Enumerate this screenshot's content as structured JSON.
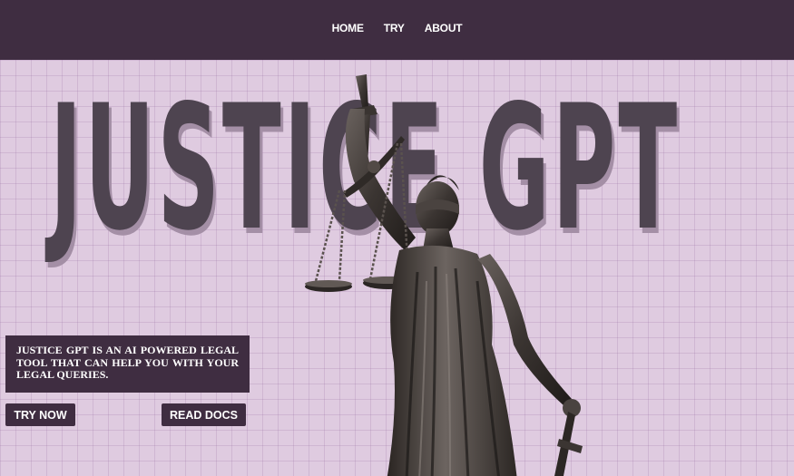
{
  "nav": {
    "items": [
      {
        "label": "HOME"
      },
      {
        "label": "TRY"
      },
      {
        "label": "ABOUT"
      }
    ]
  },
  "hero": {
    "title": "JUSTICE GPT",
    "description": "JUSTICE GPT IS AN AI POWERED LEGAL TOOL THAT CAN HELP YOU WITH YOUR LEGAL QUERIES.",
    "try_label": "TRY NOW",
    "docs_label": "READ DOCS"
  },
  "colors": {
    "nav_bg": "#3f2d41",
    "hero_bg": "#dfcbe0",
    "title": "#4e4450",
    "button_bg": "#3f2d41",
    "text_light": "#ffffff"
  },
  "images": {
    "statue": "lady-justice-statue"
  }
}
